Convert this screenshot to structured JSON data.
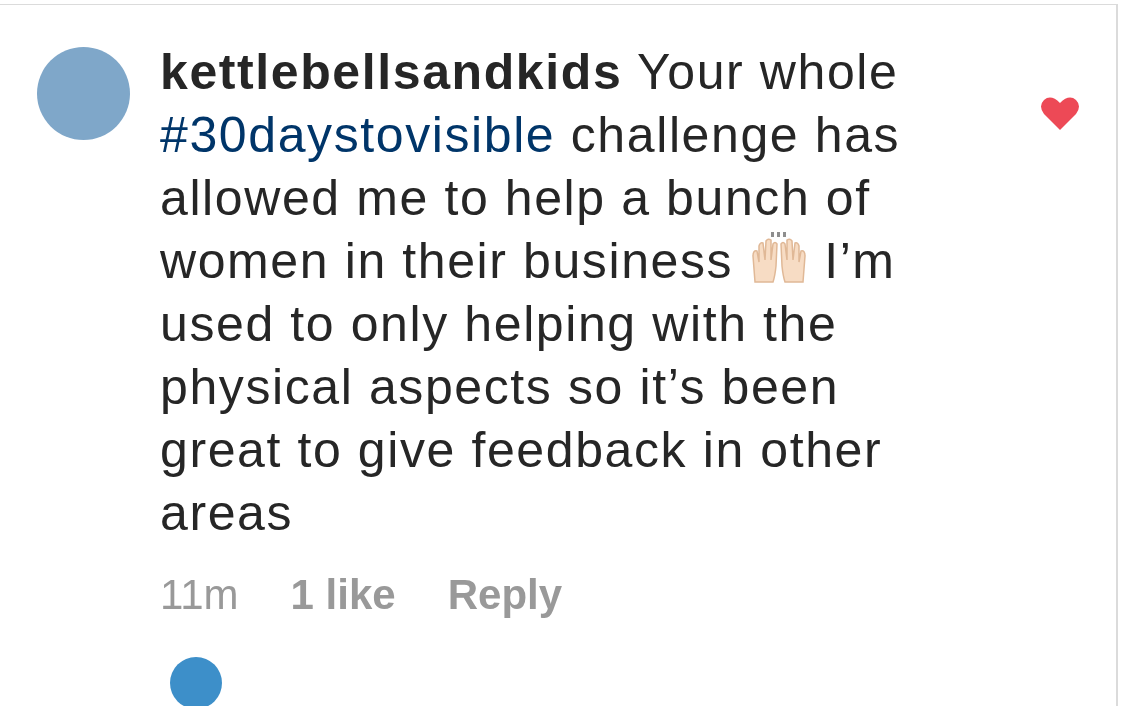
{
  "comment": {
    "username": "kettlebellsandkids",
    "parts": [
      {
        "kind": "text",
        "text": "Your whole "
      },
      {
        "kind": "hashtag",
        "text": "#30daystovisible"
      },
      {
        "kind": "text",
        "text": " challenge has allowed me to help a bunch of women in their business "
      },
      {
        "kind": "emoji"
      },
      {
        "kind": "text",
        "text": " I’m used to only helping with the physical aspects so it’s been great to give feedback in other areas"
      }
    ],
    "liked": true,
    "time": "11m",
    "likes": "1 like",
    "reply": "Reply"
  }
}
